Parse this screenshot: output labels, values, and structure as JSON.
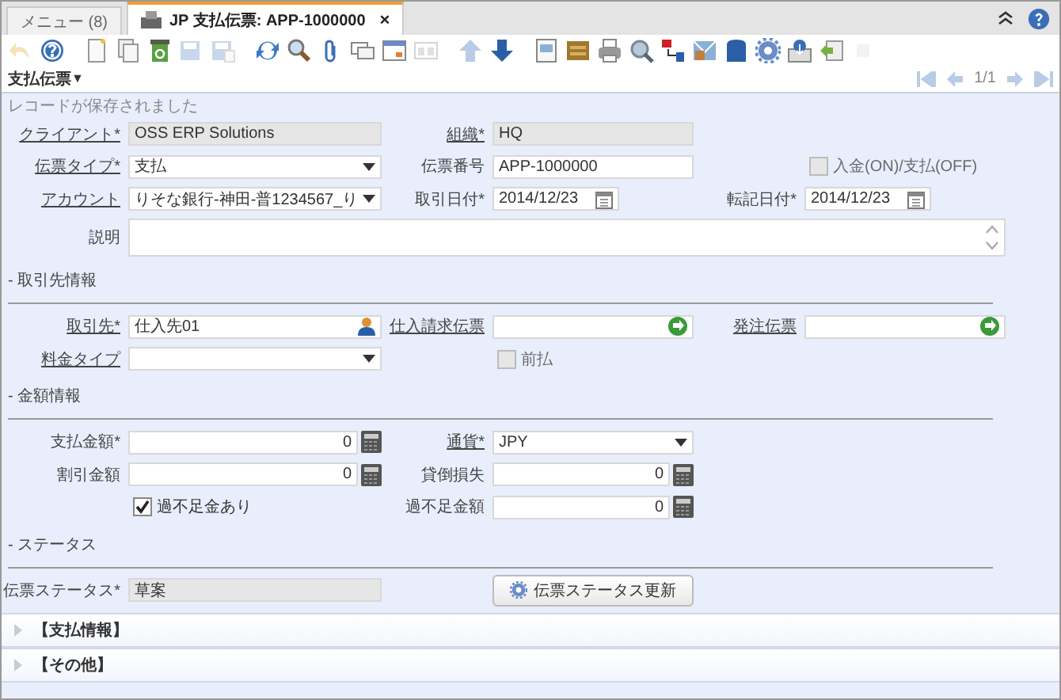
{
  "tabs": [
    {
      "label": "メニュー (8)",
      "selected": false
    },
    {
      "label": "JP 支払伝票: APP-1000000",
      "selected": true,
      "close": "×"
    }
  ],
  "toolbar": [
    [
      {
        "kind": "undo",
        "disabled": true
      },
      {
        "kind": "help",
        "disabled": false
      }
    ],
    [
      {
        "kind": "new",
        "disabled": false
      },
      {
        "kind": "copy",
        "disabled": false
      },
      {
        "kind": "delete",
        "disabled": false
      },
      {
        "kind": "save",
        "disabled": true
      },
      {
        "kind": "save-new",
        "disabled": true
      }
    ],
    [
      {
        "kind": "refresh",
        "disabled": false
      },
      {
        "kind": "find",
        "disabled": false
      },
      {
        "kind": "attach",
        "disabled": false
      },
      {
        "kind": "chat",
        "disabled": false
      },
      {
        "kind": "calendar",
        "disabled": false
      },
      {
        "kind": "window",
        "disabled": true
      }
    ],
    [
      {
        "kind": "up",
        "disabled": true
      },
      {
        "kind": "down",
        "disabled": false
      }
    ],
    [
      {
        "kind": "report",
        "disabled": false
      },
      {
        "kind": "archive",
        "disabled": false
      },
      {
        "kind": "print",
        "disabled": false
      },
      {
        "kind": "zoom",
        "disabled": false
      },
      {
        "kind": "workflow",
        "disabled": false
      },
      {
        "kind": "request",
        "disabled": false
      },
      {
        "kind": "product",
        "disabled": false
      },
      {
        "kind": "process",
        "disabled": false
      },
      {
        "kind": "export",
        "disabled": false
      },
      {
        "kind": "import",
        "disabled": false
      },
      {
        "kind": "extra",
        "disabled": true
      }
    ]
  ],
  "breadcrumb": {
    "title": "支払伝票",
    "caret": "▼"
  },
  "pager": {
    "position": "1/1",
    "buttons": [
      {
        "kind": "first",
        "disabled": true
      },
      {
        "kind": "prev",
        "disabled": true
      },
      {
        "kind": "next",
        "disabled": true
      },
      {
        "kind": "last",
        "disabled": true
      }
    ]
  },
  "message": "レコードが保存されました",
  "form": [
    {
      "rows": [
        [
          {
            "kind": "field",
            "label": "クライアント*",
            "link": true,
            "field": {
              "kind": "text",
              "value": "OSS ERP Solutions",
              "readonly": true
            }
          },
          {
            "kind": "field",
            "label": "組織*",
            "link": true,
            "field": {
              "kind": "text",
              "value": "HQ",
              "readonly": true
            }
          }
        ],
        [
          {
            "kind": "field",
            "label": "伝票タイプ*",
            "link": true,
            "field": {
              "kind": "select",
              "value": "支払",
              "readonly": false
            }
          },
          {
            "kind": "field",
            "label": "伝票番号",
            "link": false,
            "field": {
              "kind": "text",
              "value": "APP-1000000",
              "readonly": false
            }
          },
          {
            "kind": "checkbox",
            "label": "入金(ON)/支払(OFF)",
            "checked": false,
            "disabled": true
          }
        ],
        [
          {
            "kind": "field",
            "label": "アカウント",
            "link": true,
            "field": {
              "kind": "select",
              "value": "りそな銀行-神田-普1234567_り",
              "readonly": false
            }
          },
          {
            "kind": "field",
            "label": "取引日付*",
            "link": false,
            "field": {
              "kind": "date",
              "value": "2014/12/23",
              "readonly": false
            }
          },
          {
            "kind": "field",
            "label": "転記日付*",
            "link": false,
            "field": {
              "kind": "date",
              "value": "2014/12/23",
              "readonly": false
            }
          }
        ],
        [
          {
            "kind": "field",
            "label": "説明",
            "link": false,
            "field": {
              "kind": "textarea",
              "readonly": false
            }
          }
        ]
      ]
    },
    {
      "heading": "- 取引先情報",
      "rows": [
        [
          {
            "kind": "field",
            "label": "取引先*",
            "link": true,
            "field": {
              "kind": "partner_lookup",
              "value": "仕入先01",
              "readonly": false
            }
          },
          {
            "kind": "field",
            "label": "仕入請求伝票",
            "link": true,
            "field": {
              "kind": "document_lookup",
              "readonly": false
            }
          },
          {
            "kind": "field",
            "label": "発注伝票",
            "link": true,
            "field": {
              "kind": "document_lookup",
              "readonly": false
            }
          }
        ],
        [
          {
            "kind": "field",
            "label": "料金タイプ",
            "link": true,
            "field": {
              "kind": "select",
              "readonly": false
            }
          },
          {
            "kind": "checkbox",
            "label": "前払",
            "checked": false,
            "disabled": true
          }
        ]
      ]
    },
    {
      "heading": "- 金額情報",
      "rows": [
        [
          {
            "kind": "field",
            "label": "支払金額*",
            "link": false,
            "field": {
              "kind": "amount",
              "value": "0",
              "readonly": false
            }
          },
          {
            "kind": "field",
            "label": "通貨*",
            "link": true,
            "field": {
              "kind": "select",
              "value": "JPY",
              "readonly": false
            }
          }
        ],
        [
          {
            "kind": "field",
            "label": "割引金額",
            "link": false,
            "field": {
              "kind": "amount",
              "value": "0",
              "readonly": false
            }
          },
          {
            "kind": "field",
            "label": "貸倒損失",
            "link": false,
            "field": {
              "kind": "amount",
              "value": "0",
              "readonly": false
            }
          }
        ],
        [
          {
            "kind": "checkbox",
            "label": "過不足金あり",
            "checked": true,
            "disabled": false
          },
          {
            "kind": "field",
            "label": "過不足金額",
            "link": false,
            "field": {
              "kind": "amount",
              "value": "0",
              "readonly": false
            }
          }
        ]
      ]
    },
    {
      "heading": "- ステータス",
      "rows": [
        [
          {
            "kind": "field",
            "label": "伝票ステータス*",
            "link": false,
            "field": {
              "kind": "text",
              "value": "草案",
              "readonly": true
            }
          },
          {
            "kind": "button",
            "label": "伝票ステータス更新"
          }
        ]
      ]
    }
  ],
  "collapsibles": [
    {
      "label": "【支払情報】",
      "expanded": false
    },
    {
      "label": "【その他】",
      "expanded": false
    }
  ]
}
